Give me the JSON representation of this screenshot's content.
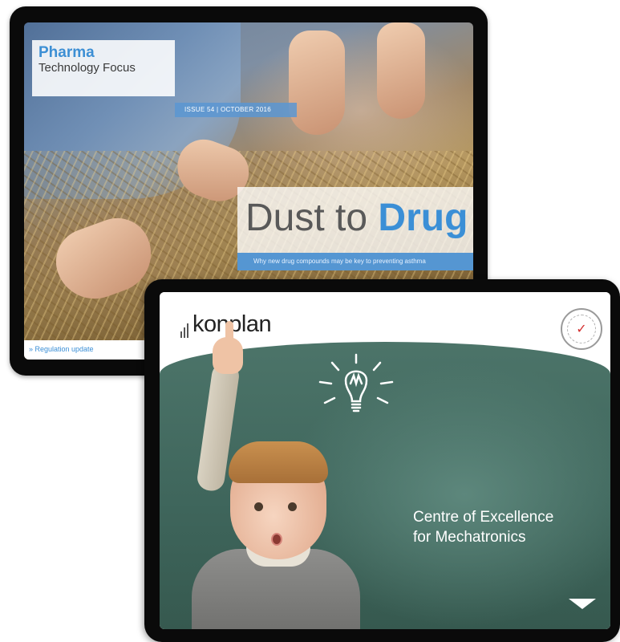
{
  "pharma": {
    "brand_title": "Pharma",
    "brand_subtitle": "Technology Focus",
    "issue_tag": "ISSUE 54 | OCTOBER 2016",
    "headline_light": "Dust to ",
    "headline_accent": "Drug",
    "subline": "Why new drug compounds may be key to preventing asthma",
    "bottom_link": "» Regulation update",
    "accent_color": "#3b8fd6"
  },
  "konplan": {
    "logo_text": "konplan",
    "seal_icon": "certification-seal-icon",
    "seal_check": "✓",
    "headline_line1": "Centre of Excellence",
    "headline_line2": "for Mechatronics",
    "next_icon": "chevron-down-icon",
    "board_color": "#4c7469"
  }
}
